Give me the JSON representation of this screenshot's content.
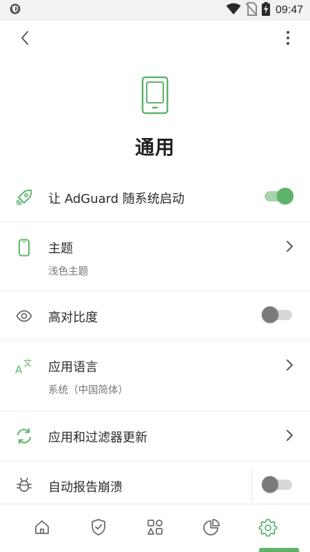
{
  "status_bar": {
    "time": "09:47",
    "icons": [
      "shield-icon",
      "wifi-icon",
      "no-sim-icon",
      "battery-charging-icon"
    ]
  },
  "app_bar": {
    "back_icon": "back-arrow-icon",
    "menu_icon": "more-vert-icon"
  },
  "header": {
    "icon": "phone-icon",
    "title": "通用"
  },
  "settings": [
    {
      "id": "autostart",
      "icon": "rocket-icon",
      "title": "让 AdGuard 随系统启动",
      "subtitle": "",
      "control": "toggle",
      "toggle_on": true
    },
    {
      "id": "theme",
      "icon": "phone-outline-icon",
      "title": "主题",
      "subtitle": "浅色主题",
      "control": "chevron"
    },
    {
      "id": "high-contrast",
      "icon": "eye-icon",
      "title": "高对比度",
      "subtitle": "",
      "control": "toggle",
      "toggle_on": false
    },
    {
      "id": "language",
      "icon": "translate-icon",
      "title": "应用语言",
      "subtitle": "系统（中国简体）",
      "control": "chevron"
    },
    {
      "id": "updates",
      "icon": "sync-icon",
      "title": "应用和过滤器更新",
      "subtitle": "",
      "control": "chevron"
    },
    {
      "id": "crash-reports",
      "icon": "bug-icon",
      "title": "自动报告崩溃",
      "subtitle": "",
      "control": "toggle",
      "toggle_on": false
    }
  ],
  "bottom_nav": [
    {
      "id": "home",
      "icon": "home-icon",
      "active": false
    },
    {
      "id": "protection",
      "icon": "shield-check-icon",
      "active": false
    },
    {
      "id": "activity",
      "icon": "apps-icon",
      "active": false
    },
    {
      "id": "statistics",
      "icon": "pie-chart-icon",
      "active": false
    },
    {
      "id": "settings",
      "icon": "gear-icon",
      "active": true
    }
  ],
  "colors": {
    "accent": "#5eb36c",
    "accent_light": "#a6d3ac",
    "text_primary": "#2a2a2a",
    "text_secondary": "#777777",
    "icon_gray": "#6b6b6b",
    "divider": "#ececec"
  }
}
